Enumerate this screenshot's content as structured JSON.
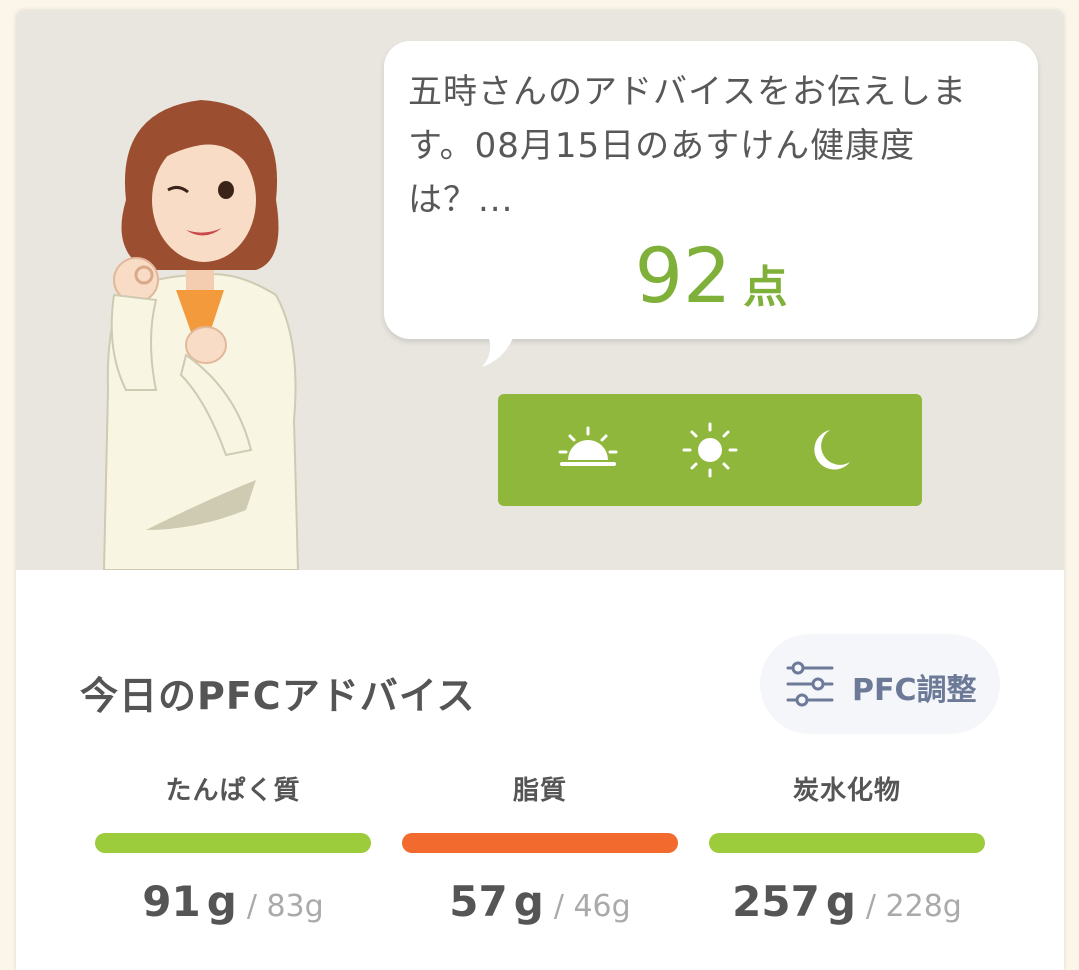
{
  "advice": {
    "message": "五時さんのアドバイスをお伝えします。08月15日のあすけん健康度は？...",
    "score_value": "92",
    "score_unit": "点"
  },
  "time_selector": {
    "buttons": [
      {
        "icon": "sunrise-icon",
        "label": "morning"
      },
      {
        "icon": "sun-icon",
        "label": "noon"
      },
      {
        "icon": "moon-icon",
        "label": "night"
      }
    ]
  },
  "pfc": {
    "title": "今日のPFCアドバイス",
    "adjust_label": "PFC調整",
    "nutrients": [
      {
        "label": "たんぱく質",
        "actual": "91",
        "unit": "g",
        "target": "/ 83g",
        "color": "#9ccc3c"
      },
      {
        "label": "脂質",
        "actual": "57",
        "unit": "g",
        "target": "/ 46g",
        "color": "#f26a2e"
      },
      {
        "label": "炭水化物",
        "actual": "257",
        "unit": "g",
        "target": "/ 228g",
        "color": "#9ccc3c"
      }
    ]
  },
  "colors": {
    "accent_green": "#8eb73c",
    "score_green": "#7fb03a",
    "hero_background": "#e8e6df"
  }
}
